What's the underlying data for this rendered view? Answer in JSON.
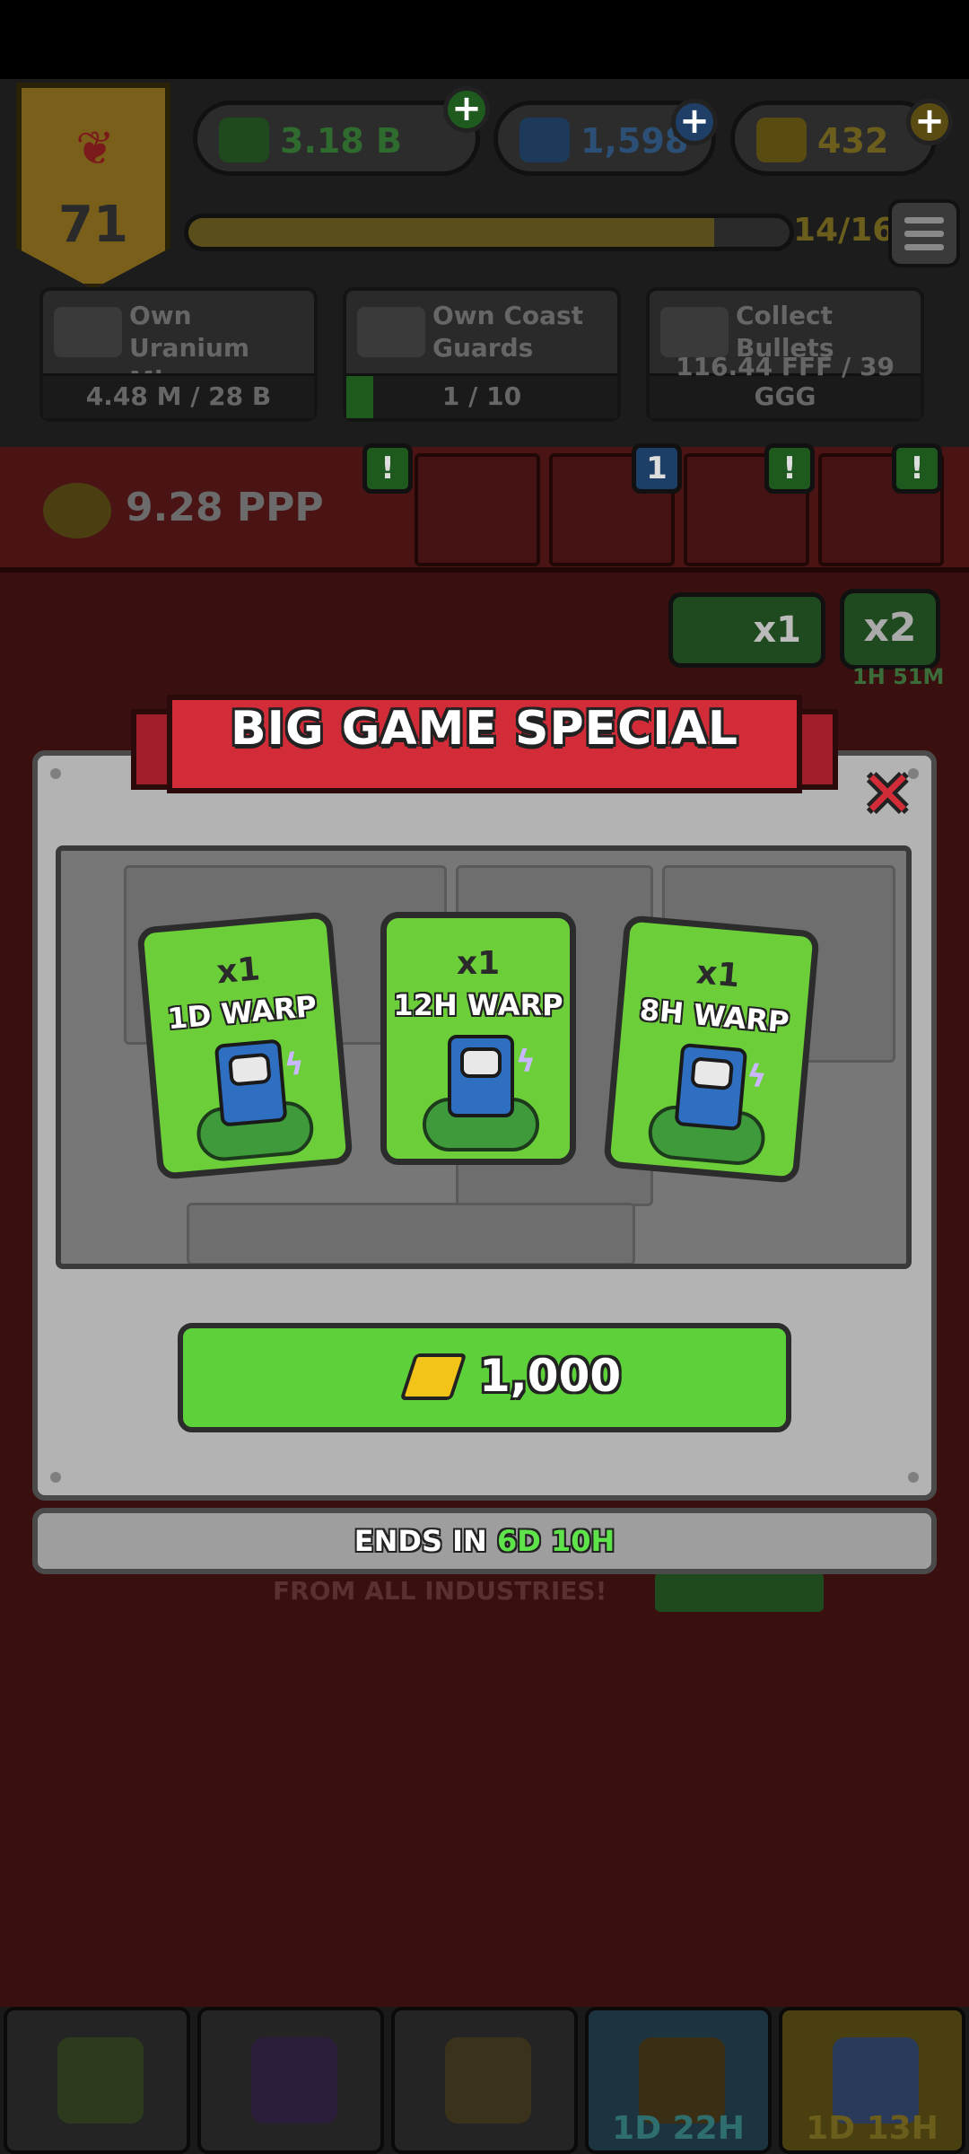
{
  "hud": {
    "level": "71",
    "cash": "3.18 B",
    "science": "1,598",
    "gold": "432",
    "progress_text": "14/16",
    "progress_fraction": 0.875
  },
  "quests": [
    {
      "name": "Own Uranium Mines",
      "progress": "4.48 M / 28 B",
      "fraction": 0.0
    },
    {
      "name": "Own Coast Guards",
      "progress": "1 / 10",
      "fraction": 0.1
    },
    {
      "name": "Collect Bullets",
      "progress": "116.44 FFF / 39 GGG",
      "fraction": 0.0
    }
  ],
  "industry": {
    "rate": "9.28 PPP",
    "badges": [
      "!",
      "1",
      "!",
      "!"
    ]
  },
  "multiplier": {
    "x1_label": "x1",
    "x2_label": "x2",
    "x2_timer": "1H 51M"
  },
  "modal": {
    "title": "BIG GAME SPECIAL",
    "close_icon": "close-x-icon",
    "cards": [
      {
        "qty": "x1",
        "title": "1D WARP",
        "icon": "warp-pack-icon"
      },
      {
        "qty": "x1",
        "title": "12H WARP",
        "icon": "warp-pack-icon"
      },
      {
        "qty": "x1",
        "title": "8H WARP",
        "icon": "warp-pack-icon"
      }
    ],
    "price": "1,000",
    "price_icon": "gold-bar-icon",
    "ends_prefix": "ENDS IN",
    "ends_days": "6D",
    "ends_hours": "10H"
  },
  "background_text": "FROM ALL INDUSTRIES!",
  "nav": {
    "items": [
      {
        "icon": "flag-icon",
        "timer": ""
      },
      {
        "icon": "cards-icon",
        "timer": ""
      },
      {
        "icon": "ticket-icon",
        "timer": ""
      },
      {
        "icon": "potato-icon",
        "timer": "1D 22H"
      },
      {
        "icon": "shop-bag-icon",
        "timer": "1D 13H"
      }
    ]
  },
  "colors": {
    "accent_green": "#5dd13a",
    "ribbon_red": "#d32c39",
    "gold": "#f2c318"
  }
}
